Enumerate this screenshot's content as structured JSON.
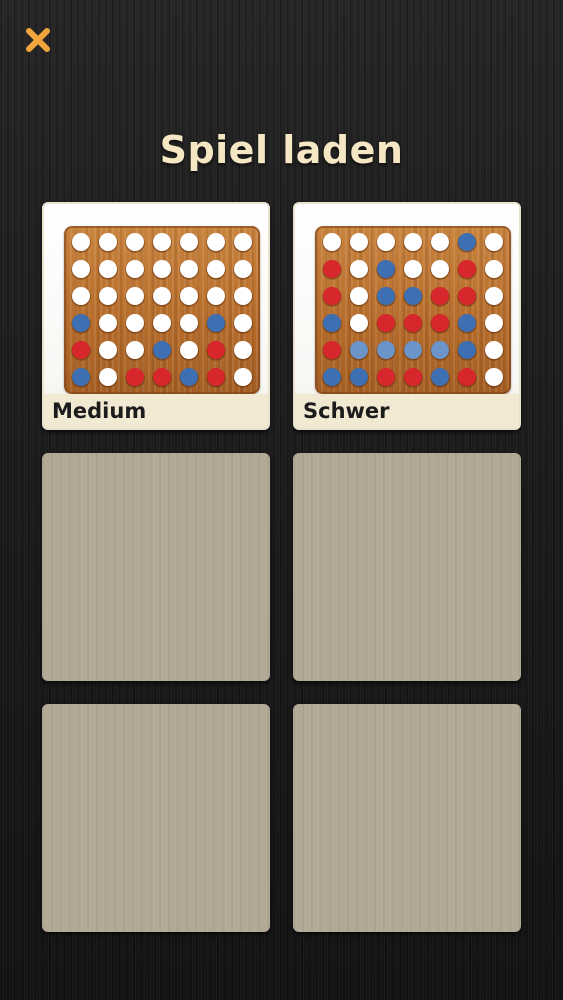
{
  "title": "Spiel laden",
  "colors": {
    "close": "#f0a63c",
    "title": "#f6e7c4",
    "red": "#d7262c",
    "blue": "#3d6fb2",
    "light_blue": "#6b94c9",
    "white": "#ffffff"
  },
  "close_icon": "close-icon",
  "slots": [
    {
      "label": "Medium",
      "board": [
        "WWWWWWW",
        "WWWWWWW",
        "WWWWWWW",
        "BWWWWBW",
        "RWWBWRW",
        "BWRRBRW"
      ]
    },
    {
      "label": "Schwer",
      "board": [
        "WWWWWBW",
        "RWBWWRW",
        "RWBBRRW",
        "BWRRRBW",
        "RLLLLBW",
        "BBRRBRW"
      ]
    }
  ],
  "empty_slot_count": 4
}
